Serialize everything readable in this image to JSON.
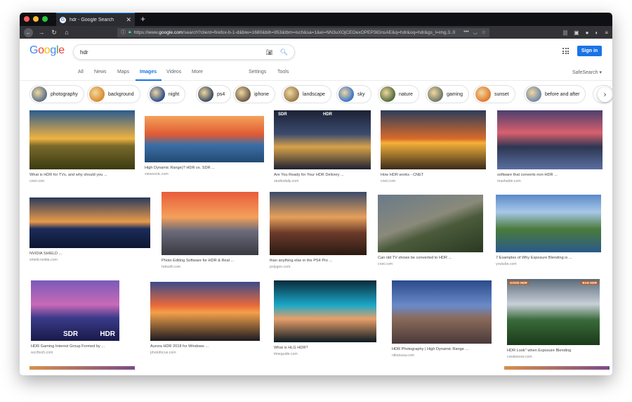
{
  "browser": {
    "tab_title": "hdr - Google Search",
    "url_prefix": "https://www.",
    "url_domain": "google.com",
    "url_rest": "/search?client=firefox-b-1-d&biw=1680&bih=953&tbm=isch&sa=1&ei=NN3uXOjCEOexOPEP3lGnsAE&q=hdr&oq=hdr&gs_l=img.3..0",
    "colors": {
      "close": "#ff5f57",
      "minimize": "#febc2e",
      "maximize": "#28c840",
      "accent": "#0a84ff"
    }
  },
  "google": {
    "logo_letters": [
      "G",
      "o",
      "o",
      "g",
      "l",
      "e"
    ],
    "logo_colors": [
      "#4285f4",
      "#ea4335",
      "#fbbc05",
      "#4285f4",
      "#34a853",
      "#ea4335"
    ],
    "query": "hdr",
    "signin": "Sign in",
    "tabs": [
      "All",
      "News",
      "Maps",
      "Images",
      "Videos",
      "More",
      "Settings",
      "Tools"
    ],
    "active_tab": "Images",
    "safesearch": "SafeSearch ▾"
  },
  "chips": [
    {
      "label": "photography",
      "color": "#5b6f8a"
    },
    {
      "label": "background",
      "color": "#d98a2c"
    },
    {
      "label": "night",
      "color": "#2c4d8a"
    },
    {
      "label": "ps4",
      "color": "#3b4a62"
    },
    {
      "label": "iphone",
      "color": "#6c5a48"
    },
    {
      "label": "landscape",
      "color": "#9a7a4b"
    },
    {
      "label": "sky",
      "color": "#3a74c8"
    },
    {
      "label": "nature",
      "color": "#4f6a3a"
    },
    {
      "label": "gaming",
      "color": "#6e7766"
    },
    {
      "label": "sunset",
      "color": "#e0792c"
    },
    {
      "label": "before and after",
      "color": "#7189a8"
    }
  ],
  "results": [
    {
      "caption": "What is HDR for TVs, and why should you ...",
      "domain": "cnet.com",
      "bg": "linear-gradient(180deg,#2b5b8f 0%,#f0b341 48%,#7a6a2a 60%,#3a3a12 100%)"
    },
    {
      "caption": "High Dynamic Range)? HDR vs. SDR ...",
      "domain": "viewsonic.com",
      "bg": "linear-gradient(180deg,#f4a25a 0%,#e05a34 40%,#3b6fa8 62%,#234a72 100%)"
    },
    {
      "caption": "Are You Ready for Your HDR Delivery ...",
      "domain": "studiodaily.com",
      "bg": "linear-gradient(180deg,#1c2235 0%,#3b4a6e 40%,#d7a24a 62%,#1f2233 100%)",
      "sdr": "SDR",
      "hdr": "HDR"
    },
    {
      "caption": "How HDR works - CNET",
      "domain": "cnet.com",
      "bg": "linear-gradient(180deg,#2c3d5b 0%,#d86a2a 48%,#f4b13a 55%,#3a2a1a 100%)"
    },
    {
      "caption": "software that converts non-HDR ...",
      "domain": "mashable.com",
      "bg": "linear-gradient(180deg,#4a3f6e 0%,#d9606e 38%,#2d3652 62%,#5a6fa0 100%)"
    },
    {
      "caption": "NVIDIA SHIELD ...",
      "domain": "shield.nvidia.com",
      "bg": "linear-gradient(180deg,#2a3a5c 0%,#e89a4a 48%,#1a2c5a 62%,#0d1530 100%)"
    },
    {
      "caption": "Photo Editing Software for HDR & Real ...",
      "domain": "hdrsoft.com",
      "bg": "linear-gradient(180deg,#e85c3a 0%,#f4a05a 40%,#6a6a7a 62%,#3a3a42 100%)"
    },
    {
      "caption": "than anything else in the PS4 Pro ...",
      "domain": "polygon.com",
      "bg": "linear-gradient(180deg,#3a4a6a 0%,#e6a05a 40%,#6a3a2a 65%,#2a1a12 100%)"
    },
    {
      "caption": "Can old TV shows be converted to HDR ...",
      "domain": "cnet.com",
      "bg": "linear-gradient(160deg,#6a7a8a 0%,#8a8a7a 45%,#4a5a3a 60%,#2a3a22 100%)"
    },
    {
      "caption": "7 Examples of Why Exposure Blending is ...",
      "domain": "youtube.com",
      "bg": "linear-gradient(180deg,#5a8ac8 0%,#a8c8e8 30%,#4a7a3a 60%,#2a5a8a 100%)"
    },
    {
      "caption": "HDR Gaming Interest Group Formed by ...",
      "domain": "wccftech.com",
      "bg": "linear-gradient(180deg,#7a5ab8 0%,#c86ab8 40%,#3a3a8a 62%,#1a1a4a 100%)",
      "sdr": "SDR",
      "hdr": "HDR"
    },
    {
      "caption": "Aurora HDR 2018 for Windows ...",
      "domain": "photofocus.com",
      "bg": "linear-gradient(180deg,#3a4a8a 0%,#e86a3a 40%,#f4a04a 52%,#1a1a22 100%)"
    },
    {
      "caption": "What is HLG HDR?",
      "domain": "timeguide.com",
      "bg": "linear-gradient(180deg,#0a2a3a 0%,#1aa8c8 40%,#e8a06a 62%,#0a1a22 100%)"
    },
    {
      "caption": "HDR Photography | High Dynamic Range ...",
      "domain": "nikonusa.com",
      "bg": "linear-gradient(180deg,#2a4a8a 0%,#6a8ac8 40%,#8a6a5a 60%,#4a3a3a 100%)"
    },
    {
      "caption": "HDR Look\" when Exposure Blending",
      "domain": "creativeow.com",
      "bg": "linear-gradient(180deg,#5a6a7a 0%,#c8d0d8 38%,#3a6a3a 62%,#1a3a1a 100%)",
      "good": "GOOD HDR",
      "bad": "BAD HDR"
    }
  ]
}
